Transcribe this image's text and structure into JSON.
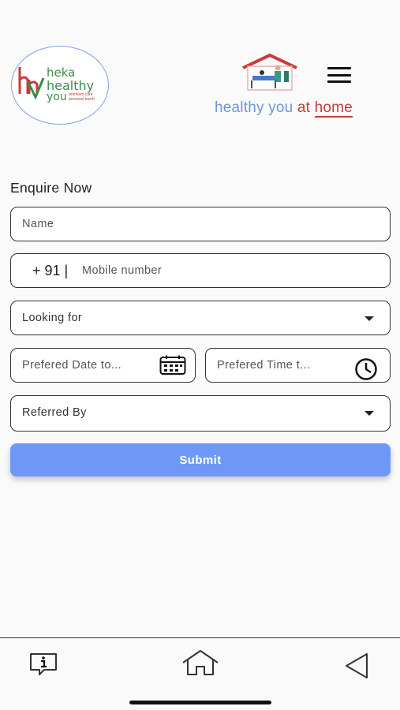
{
  "header": {
    "logo": {
      "line1": "heka",
      "line2": "healthy",
      "line3": "you",
      "tagline": "premium care personal touch"
    },
    "tagline": {
      "part1": "healthy you ",
      "part2": "at ",
      "part3": "home"
    },
    "menu_icon": "hamburger-menu-icon"
  },
  "form": {
    "title": "Enquire Now",
    "name_placeholder": "Name",
    "mobile_prefix": "+ 91 |",
    "mobile_placeholder": "Mobile number",
    "looking_for_placeholder": "Looking for",
    "date_placeholder": "Prefered Date to...",
    "time_placeholder": "Prefered Time t...",
    "referred_by_placeholder": "Referred By",
    "submit_label": "Submit"
  },
  "bottom_nav": {
    "items": [
      {
        "icon": "info-chat-icon"
      },
      {
        "icon": "home-icon"
      },
      {
        "icon": "back-triangle-icon"
      }
    ]
  },
  "colors": {
    "accent_blue": "#6f98f6",
    "brand_red": "#c93a3a",
    "brand_green": "#3a8a4a",
    "tagline_blue": "#6f95e0"
  }
}
